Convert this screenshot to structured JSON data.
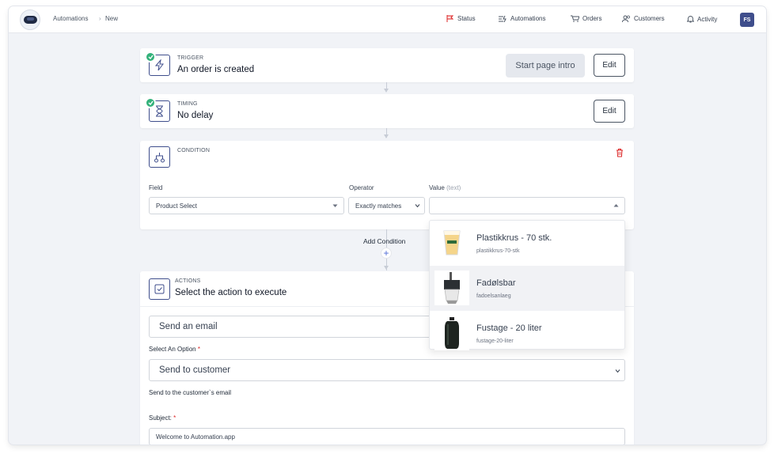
{
  "topbar": {
    "breadcrumb": [
      "Automations",
      "New"
    ],
    "breadcrumb_sep": "›",
    "nav": [
      {
        "label": "Status",
        "icon": "flag-icon"
      },
      {
        "label": "Automations",
        "icon": "automations-icon"
      },
      {
        "label": "Orders",
        "icon": "cart-icon"
      },
      {
        "label": "Customers",
        "icon": "users-icon"
      },
      {
        "label": "Activity",
        "icon": "bell-icon"
      }
    ],
    "avatar_initials": "FS"
  },
  "trigger": {
    "kicker": "TRIGGER",
    "title": "An order is created",
    "intro_button": "Start page intro",
    "edit_button": "Edit"
  },
  "timing": {
    "kicker": "TIMING",
    "title": "No delay",
    "edit_button": "Edit"
  },
  "condition": {
    "kicker": "CONDITION",
    "field_label": "Field",
    "operator_label": "Operator",
    "value_label": "Value",
    "value_label_hint": "(text)",
    "field_value": "Product Select",
    "operator_value": "Exactly matches",
    "value_value": "",
    "add_condition": "Add Condition",
    "add_symbol": "+"
  },
  "dropdown": {
    "options": [
      {
        "name": "Plastikkrus - 70 stk.",
        "slug": "plastikkrus-70-stk"
      },
      {
        "name": "Fadølsbar",
        "slug": "fadoelsanlaeg"
      },
      {
        "name": "Fustage - 20 liter",
        "slug": "fustage-20-liter"
      }
    ]
  },
  "actions": {
    "kicker": "ACTIONS",
    "title": "Select the action to execute",
    "action_value": "Send an email",
    "option_label": "Select An Option",
    "option_value": "Send to customer",
    "option_hint": "Send to the customer`s email",
    "subject_label": "Subject:",
    "subject_value": "Welcome to Automation.app",
    "required_mark": "*"
  },
  "colors": {
    "accent": "#3f4e8c",
    "check": "#34b27b",
    "danger": "#dc2626",
    "background": "#f1f3f7"
  }
}
